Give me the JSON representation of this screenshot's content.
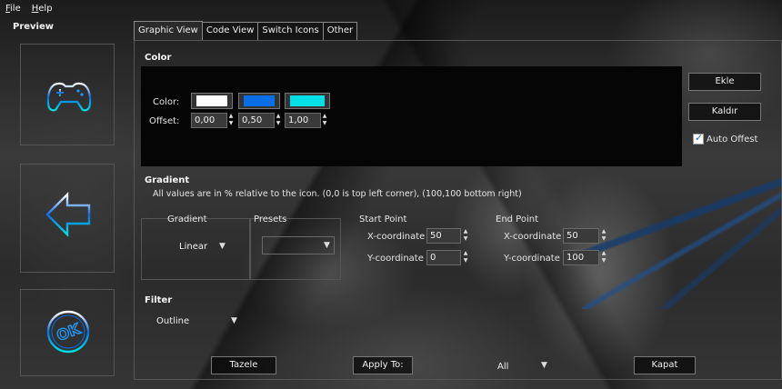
{
  "menu": {
    "file": "File",
    "help": "Help"
  },
  "preview": {
    "label": "Preview",
    "icons": [
      "gamepad-icon",
      "back-arrow-icon",
      "ok-icon"
    ],
    "accent": "#1f9bff"
  },
  "tabs": [
    {
      "label": "Graphic View",
      "active": true
    },
    {
      "label": "Code View",
      "active": false
    },
    {
      "label": "Switch Icons",
      "active": false
    },
    {
      "label": "Other",
      "active": false
    }
  ],
  "color_section": {
    "title": "Color",
    "color_label": "Color:",
    "offset_label": "Offset:",
    "stops": [
      {
        "color": "#ffffff",
        "offset": "0,00"
      },
      {
        "color": "#0a6ee6",
        "offset": "0,50"
      },
      {
        "color": "#00e0e6",
        "offset": "1,00"
      }
    ],
    "add_button": "Ekle",
    "remove_button": "Kaldır",
    "auto_offset": {
      "label": "Auto Offest",
      "checked": true
    }
  },
  "gradient_section": {
    "title": "Gradient",
    "note": "All values are in % relative to the icon. (0,0 is top left corner), (100,100 bottom right)",
    "gradient_label": "Gradient",
    "gradient_value": "Linear",
    "presets_label": "Presets",
    "presets_value": "",
    "start_point": {
      "label": "Start Point",
      "x_label": "X-coordinate",
      "x": "50",
      "y_label": "Y-coordinate",
      "y": "0"
    },
    "end_point": {
      "label": "End Point",
      "x_label": "X-coordinate",
      "x": "50",
      "y_label": "Y-coordinate",
      "y": "100"
    }
  },
  "filter_section": {
    "title": "Filter",
    "value": "Outline"
  },
  "footer": {
    "refresh_button": "Tazele",
    "apply_button": "Apply To:",
    "apply_target": "All",
    "close_button": "Kapat"
  }
}
